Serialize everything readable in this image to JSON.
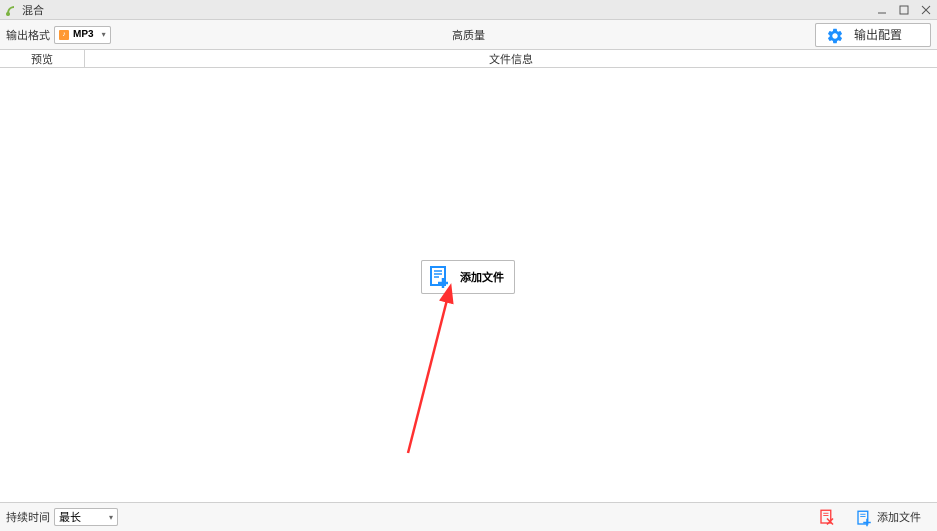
{
  "window": {
    "title": "混合"
  },
  "toolbar": {
    "format_label": "输出格式",
    "format_value": "MP3",
    "quality_label": "高质量",
    "output_config": "输出配置"
  },
  "columns": {
    "preview": "预览",
    "fileinfo": "文件信息"
  },
  "main": {
    "add_file": "添加文件"
  },
  "bottom": {
    "duration_label": "持续时间",
    "duration_value": "最长",
    "add_file": "添加文件"
  },
  "colors": {
    "accent_blue": "#1e90ff",
    "accent_orange": "#ff9933",
    "accent_red": "#ff3030"
  }
}
